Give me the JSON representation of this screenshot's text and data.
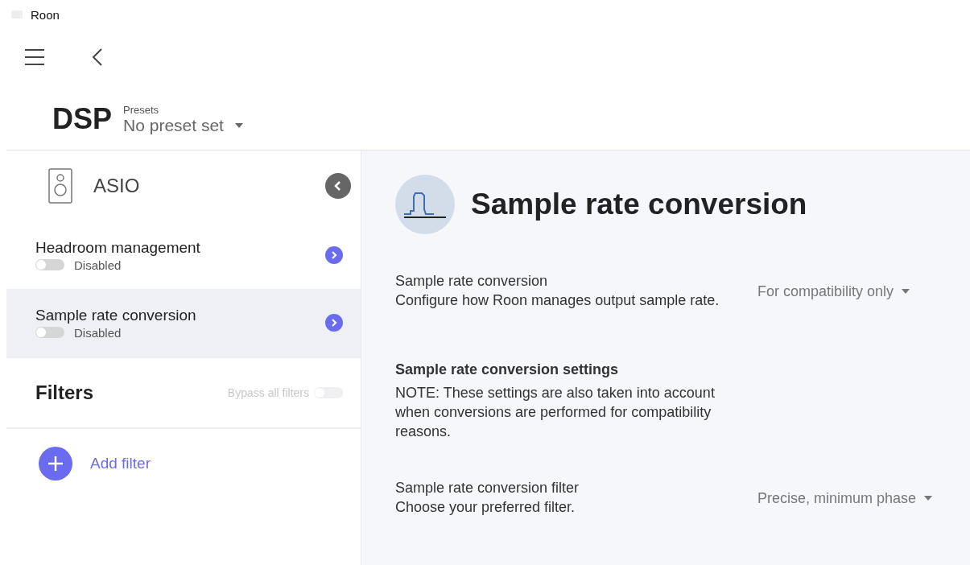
{
  "window": {
    "title": "Roon"
  },
  "page": {
    "title": "DSP",
    "presets_label": "Presets",
    "preset_value": "No preset set"
  },
  "device": {
    "name": "ASIO"
  },
  "dsp_items": [
    {
      "name": "Headroom management",
      "status": "Disabled",
      "enabled": false,
      "selected": false
    },
    {
      "name": "Sample rate conversion",
      "status": "Disabled",
      "enabled": false,
      "selected": true
    }
  ],
  "filters": {
    "title": "Filters",
    "bypass_label": "Bypass all filters",
    "bypass_on": false,
    "add_label": "Add filter"
  },
  "detail": {
    "title": "Sample rate conversion",
    "settings": [
      {
        "kind": "dropdown",
        "label": "Sample rate conversion",
        "description": "Configure how Roon manages output sample rate.",
        "value": "For compatibility only"
      },
      {
        "kind": "heading",
        "label": "Sample rate conversion settings",
        "description": "NOTE: These settings are also taken into account when conversions are performed for compatibility reasons."
      },
      {
        "kind": "dropdown",
        "label": "Sample rate conversion filter",
        "description": "Choose your preferred filter.",
        "value": "Precise, minimum phase"
      }
    ]
  }
}
